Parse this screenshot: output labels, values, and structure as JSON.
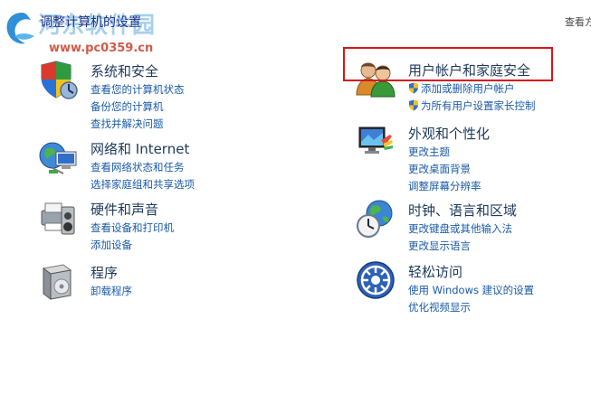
{
  "header": {
    "title": "调整计算机的设置",
    "view_by": "查看方"
  },
  "watermark": {
    "text": "河东软件园",
    "url": "www.pc0359.cn"
  },
  "colors": {
    "title": "#1e395b",
    "link": "#1a5aa8",
    "highlight": "#d9141b"
  },
  "categories": [
    {
      "icon": "security-shield-icon",
      "title": "系统和安全",
      "links": [
        "查看您的计算机状态",
        "备份您的计算机",
        "查找并解决问题"
      ]
    },
    {
      "icon": "network-globe-icon",
      "title": "网络和 Internet",
      "links": [
        "查看网络状态和任务",
        "选择家庭组和共享选项"
      ]
    },
    {
      "icon": "printer-sound-icon",
      "title": "硬件和声音",
      "links": [
        "查看设备和打印机",
        "添加设备"
      ]
    },
    {
      "icon": "programs-box-icon",
      "title": "程序",
      "links": [
        "卸载程序"
      ]
    },
    {
      "icon": "users-icon",
      "title": "用户帐户和家庭安全",
      "links": [
        "添加或删除用户帐户",
        "为所有用户设置家长控制"
      ]
    },
    {
      "icon": "appearance-monitor-icon",
      "title": "外观和个性化",
      "links": [
        "更改主题",
        "更改桌面背景",
        "调整屏幕分辨率"
      ]
    },
    {
      "icon": "clock-globe-icon",
      "title": "时钟、语言和区域",
      "links": [
        "更改键盘或其他输入法",
        "更改显示语言"
      ]
    },
    {
      "icon": "ease-of-access-icon",
      "title": "轻松访问",
      "links": [
        "使用 Windows 建议的设置",
        "优化视频显示"
      ]
    }
  ]
}
